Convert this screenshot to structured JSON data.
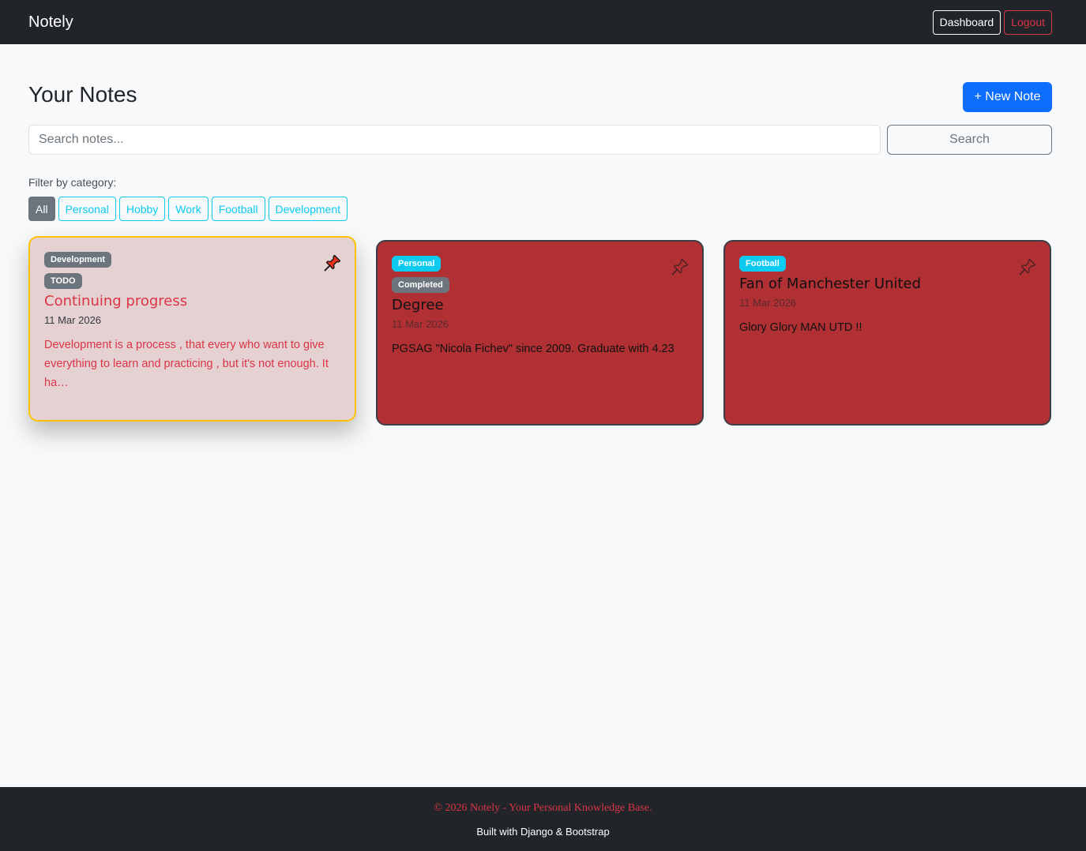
{
  "navbar": {
    "brand": "Notely",
    "dashboard_label": "Dashboard",
    "logout_label": "Logout"
  },
  "header": {
    "title": "Your Notes",
    "new_note_label": "+ New Note"
  },
  "search": {
    "placeholder": "Search notes...",
    "button_label": "Search"
  },
  "filters": {
    "label": "Filter by category:",
    "items": [
      "All",
      "Personal",
      "Hobby",
      "Work",
      "Football",
      "Development"
    ],
    "active": "All"
  },
  "notes": [
    {
      "category": "Development",
      "status": "TODO",
      "title": "Continuing progress",
      "date": "11 Mar 2026",
      "excerpt": "Development is a process , that every who want to give everything to learn and practicing , but it's not enough. It ha…",
      "pinned": true
    },
    {
      "category": "Personal",
      "status": "Completed",
      "title": "Degree",
      "date": "11 Mar 2026",
      "excerpt": "PGSAG \"Nicola Fichev\" since 2009. Graduate with 4.23",
      "pinned": false
    },
    {
      "category": "Football",
      "status": "",
      "title": "Fan of Manchester United",
      "date": "11 Mar 2026",
      "excerpt": "Glory Glory MAN UTD !!",
      "pinned": false
    }
  ],
  "footer": {
    "copyright": "© 2026 Notely - Your Personal Knowledge Base.",
    "built_with": "Built with Django & Bootstrap"
  },
  "colors": {
    "navbar": "#212529",
    "primary": "#0d6efd",
    "info": "#0dcaf0",
    "danger": "#dc3545",
    "pinned_border": "#ffc107",
    "card_red": "#b03034"
  },
  "icons": {
    "pin": "pushpin-icon"
  }
}
